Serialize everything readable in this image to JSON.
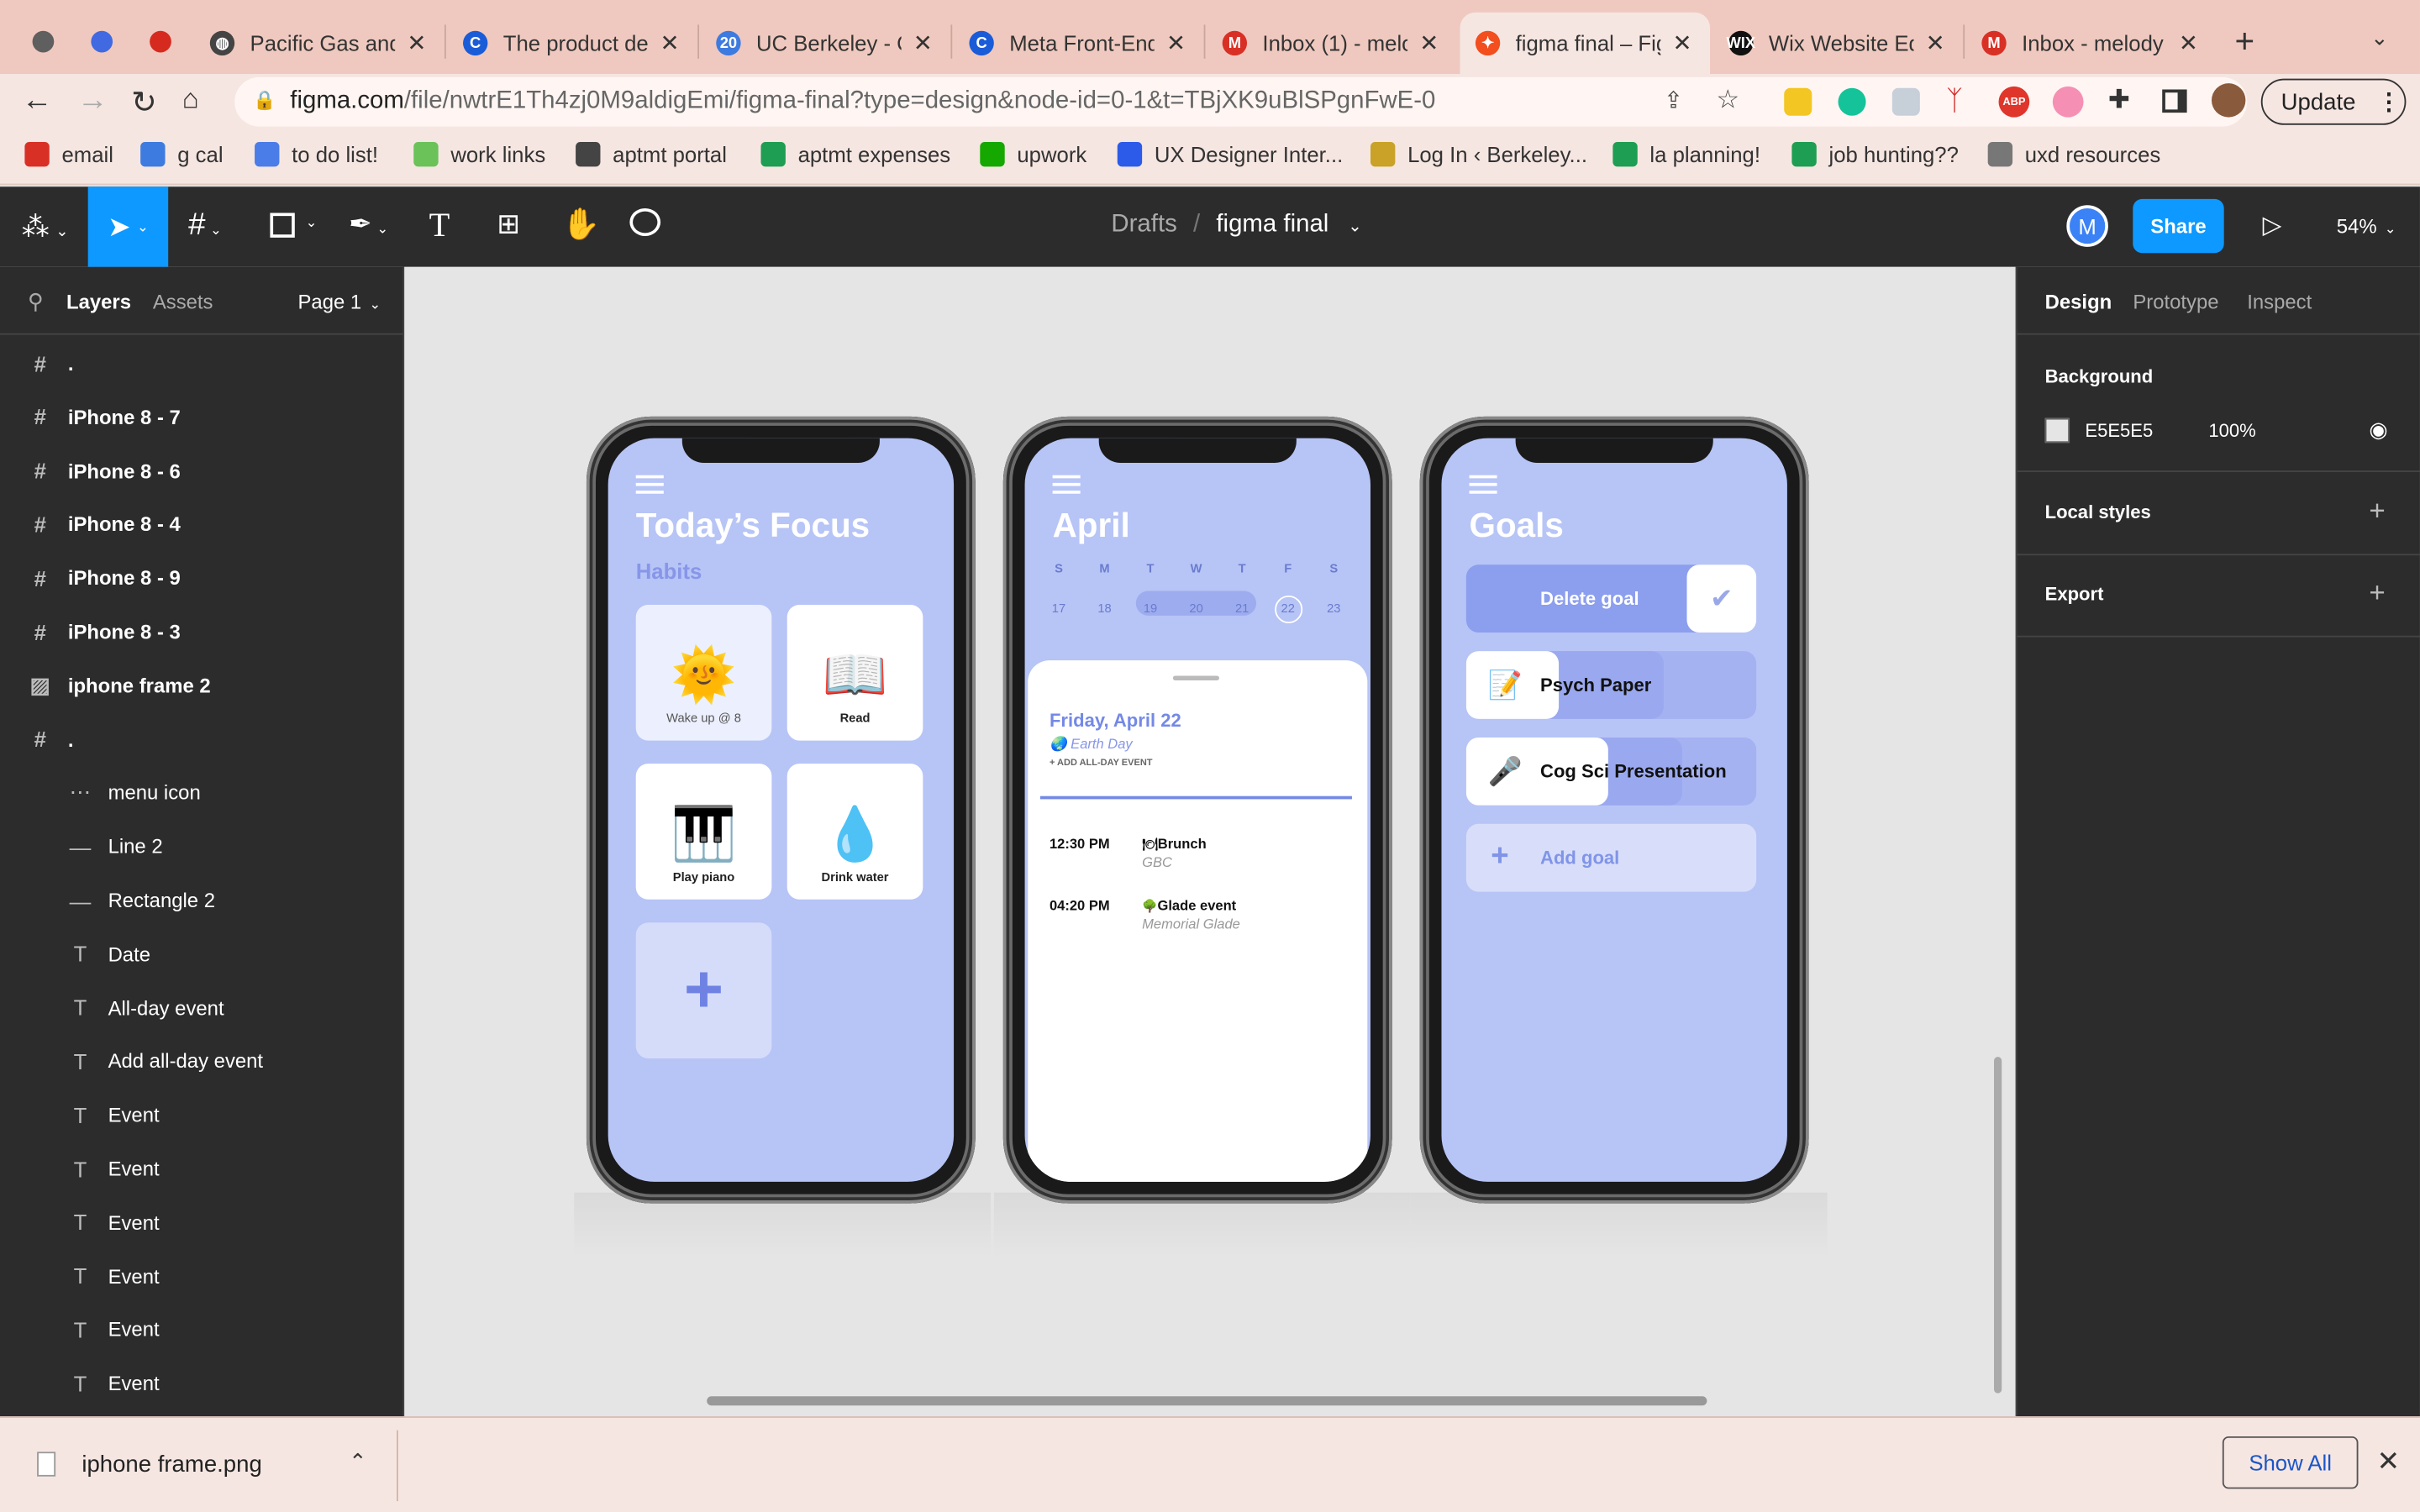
{
  "tabs": [
    {
      "title": "Pacific Gas and",
      "color": "#444",
      "glyph": "◍"
    },
    {
      "title": "The product de",
      "color": "#1a5cd8",
      "glyph": "C"
    },
    {
      "title": "UC Berkeley - C",
      "color": "#3d7be0",
      "glyph": "20"
    },
    {
      "title": "Meta Front-End",
      "color": "#1a5cd8",
      "glyph": "C"
    },
    {
      "title": "Inbox (1) - melo",
      "color": "#d93025",
      "glyph": "M"
    },
    {
      "title": "figma final – Fig",
      "color": "#f24e1e",
      "glyph": "✦"
    },
    {
      "title": "Wix Website Ed",
      "color": "#111",
      "glyph": "WIX"
    },
    {
      "title": "Inbox - melody",
      "color": "#d93025",
      "glyph": "M"
    }
  ],
  "url": {
    "host": "figma.com",
    "path": "/file/nwtrE1Th4zj0M9aldigEmi/figma-final?type=design&node-id=0-1&t=TBjXK9uBlSPgnFwE-0"
  },
  "update_label": "Update",
  "bookmarks": [
    {
      "label": "email",
      "color": "#d93025"
    },
    {
      "label": "g cal",
      "color": "#3d7be0"
    },
    {
      "label": "to do list!",
      "color": "#4a7de8"
    },
    {
      "label": "work links",
      "color": "#6ac259"
    },
    {
      "label": "aptmt portal",
      "color": "#444"
    },
    {
      "label": "aptmt expenses",
      "color": "#1e9e52"
    },
    {
      "label": "upwork",
      "color": "#14a800"
    },
    {
      "label": "UX Designer Inter...",
      "color": "#2c5bea"
    },
    {
      "label": "Log In ‹ Berkeley...",
      "color": "#c9a227"
    },
    {
      "label": "la planning!",
      "color": "#1e9e52"
    },
    {
      "label": "job hunting??",
      "color": "#1e9e52"
    },
    {
      "label": "uxd resources",
      "color": "#777"
    }
  ],
  "figma": {
    "breadcrumb_root": "Drafts",
    "file_name": "figma final",
    "avatar": "M",
    "share": "Share",
    "zoom": "54%",
    "panel_tabs": {
      "layers": "Layers",
      "assets": "Assets",
      "page": "Page 1"
    },
    "layers": [
      {
        "label": ".",
        "icon": "#",
        "indent": 0
      },
      {
        "label": "iPhone 8 - 7",
        "icon": "#",
        "indent": 0
      },
      {
        "label": "iPhone 8 - 6",
        "icon": "#",
        "indent": 0
      },
      {
        "label": "iPhone 8 - 4",
        "icon": "#",
        "indent": 0
      },
      {
        "label": "iPhone 8 - 9",
        "icon": "#",
        "indent": 0
      },
      {
        "label": "iPhone 8 - 3",
        "icon": "#",
        "indent": 0
      },
      {
        "label": "iphone frame 2",
        "icon": "▨",
        "indent": 0
      },
      {
        "label": ".",
        "icon": "#",
        "indent": 0
      },
      {
        "label": "menu icon",
        "icon": "⋯",
        "indent": 1
      },
      {
        "label": "Line 2",
        "icon": "—",
        "indent": 1
      },
      {
        "label": "Rectangle 2",
        "icon": "—",
        "indent": 1
      },
      {
        "label": "Date",
        "icon": "T",
        "indent": 1
      },
      {
        "label": "All-day event",
        "icon": "T",
        "indent": 1
      },
      {
        "label": "Add all-day event",
        "icon": "T",
        "indent": 1
      },
      {
        "label": "Event",
        "icon": "T",
        "indent": 1
      },
      {
        "label": "Event",
        "icon": "T",
        "indent": 1
      },
      {
        "label": "Event",
        "icon": "T",
        "indent": 1
      },
      {
        "label": "Event",
        "icon": "T",
        "indent": 1
      },
      {
        "label": "Event",
        "icon": "T",
        "indent": 1
      },
      {
        "label": "Event",
        "icon": "T",
        "indent": 1
      }
    ],
    "right_tabs": {
      "design": "Design",
      "prototype": "Prototype",
      "inspect": "Inspect"
    },
    "background": {
      "heading": "Background",
      "hex": "E5E5E5",
      "opacity": "100%"
    },
    "local_styles": "Local styles",
    "export": "Export",
    "help": "?"
  },
  "phone1": {
    "title": "Today’s Focus",
    "subtitle": "Habits",
    "cards": [
      {
        "label": "Wake up @ 8",
        "emoji": "🌞"
      },
      {
        "label": "Read",
        "emoji": "📖"
      },
      {
        "label": "Play piano",
        "emoji": "🎹"
      },
      {
        "label": "Drink water",
        "emoji": "💧"
      }
    ],
    "add": "+"
  },
  "phone2": {
    "title": "April",
    "days": [
      "S",
      "M",
      "T",
      "W",
      "T",
      "F",
      "S"
    ],
    "dates": [
      "17",
      "18",
      "19",
      "20",
      "21",
      "22",
      "23"
    ],
    "date_heading": "Friday, April 22",
    "all_day": "Earth Day",
    "add_all_day": "+ ADD ALL-DAY EVENT",
    "events": [
      {
        "time": "12:30 PM",
        "name": "Brunch",
        "place": "GBC",
        "emoji": "🍽"
      },
      {
        "time": "04:20 PM",
        "name": "Glade event",
        "place": "Memorial Glade",
        "emoji": "🌳"
      }
    ]
  },
  "phone3": {
    "title": "Goals",
    "delete": "Delete goal",
    "goals": [
      {
        "label": "Psych Paper",
        "emoji": "📝"
      },
      {
        "label": "Cog Sci Presentation",
        "emoji": "🎤"
      }
    ],
    "add": "Add goal"
  },
  "download": {
    "file": "iphone frame.png",
    "show_all": "Show All"
  }
}
